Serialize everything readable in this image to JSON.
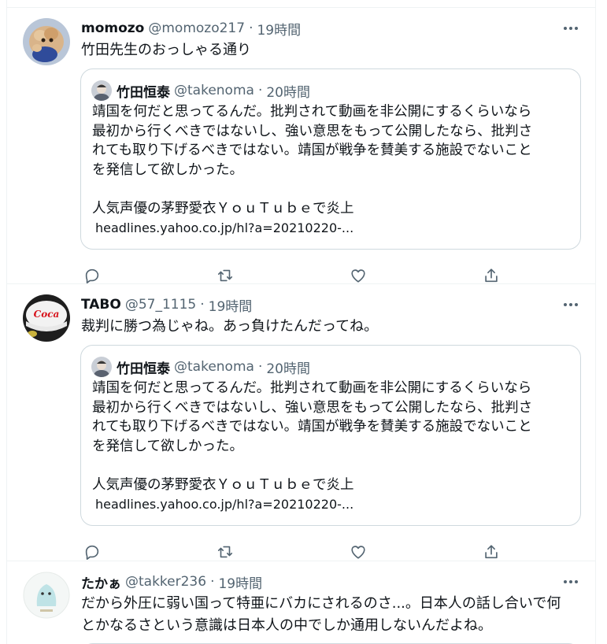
{
  "quoted_tweet": {
    "name": "竹田恒泰",
    "handle": "@takenoma",
    "time": "20時間",
    "text_lines": [
      "靖国を何だと思ってるんだ。批判されて動画を非公開にするくらいなら",
      "最初から行くべきではないし、強い意思をもって公開したなら、批判さ",
      "れても取り下げるべきではない。靖国が戦争を賛美する施設でないこと",
      "を発信して欲しかった。"
    ],
    "link_title": "人気声優の茅野愛衣ＹｏｕＴｕｂｅで炎上",
    "link_url": "headlines.yahoo.co.jp/hl?a=20210220-..."
  },
  "tweets": [
    {
      "name": "momozo",
      "handle": "@momozo217",
      "separator": "·",
      "time": "19時間",
      "text": "竹田先生のおっしゃる通り"
    },
    {
      "name": "TABO",
      "handle": "@57_1115",
      "separator": "·",
      "time": "19時間",
      "text": "裁判に勝つ為じゃね。あっ負けたんだってね。"
    },
    {
      "name": "たかぁ",
      "handle": "@takker236",
      "separator": "·",
      "time": "19時間",
      "text_lines": [
        "だから外圧に弱い国って特亜にバカにされるのさ...。日本人の話し合いで何",
        "とかなるさという意識は日本人の中でしか通用しないんだよね。"
      ]
    }
  ],
  "icons": {
    "more": "more-horizontal-icon",
    "reply": "reply-icon",
    "retweet": "retweet-icon",
    "like": "like-heart-icon",
    "share": "share-icon"
  },
  "colors": {
    "text_primary": "#0f1419",
    "text_secondary": "#536471",
    "border": "#cfd9de",
    "divider": "#eff3f4"
  }
}
